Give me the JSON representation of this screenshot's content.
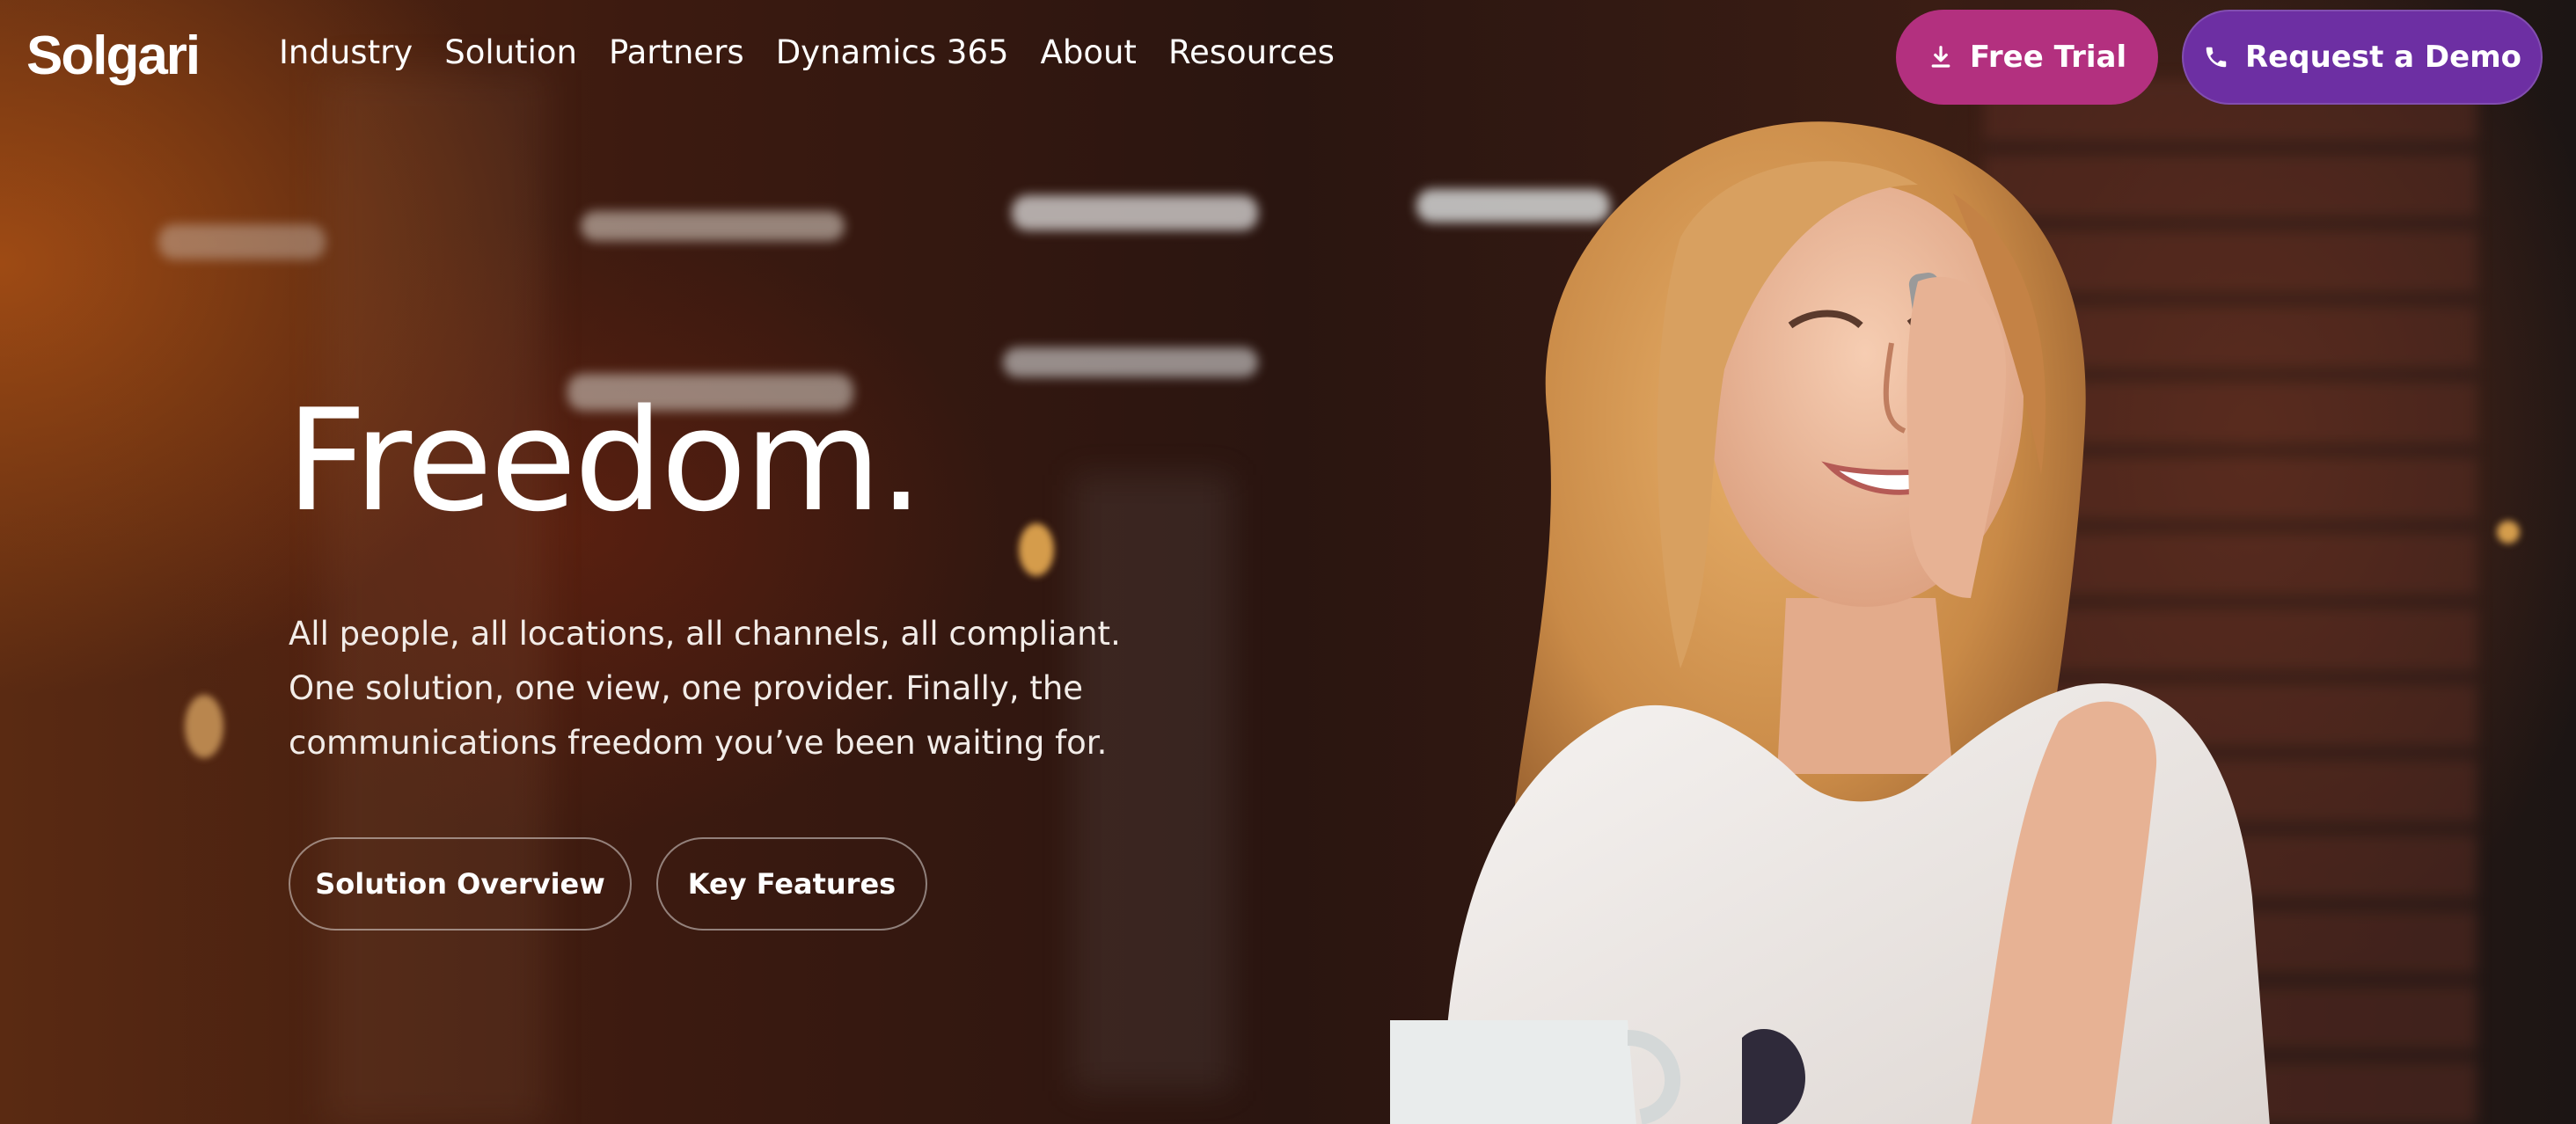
{
  "brand": {
    "logo": "Solgari"
  },
  "nav": {
    "items": [
      "Industry",
      "Solution",
      "Partners",
      "Dynamics 365",
      "About",
      "Resources"
    ]
  },
  "cta": {
    "trial_label": "Free Trial",
    "demo_label": "Request a Demo"
  },
  "hero": {
    "headline": "Freedom.",
    "description_lines": [
      "All people, all locations, all channels, all compliant.",
      "One solution, one view, one provider. Finally, the",
      "communications freedom you’ve been waiting for."
    ],
    "buttons": {
      "overview": "Solution Overview",
      "features": "Key Features"
    }
  },
  "colors": {
    "trial_button": "#b3307f",
    "demo_button": "#6d2fa3",
    "text": "#ffffff"
  },
  "icons": {
    "trial": "download-icon",
    "demo": "phone-icon"
  }
}
